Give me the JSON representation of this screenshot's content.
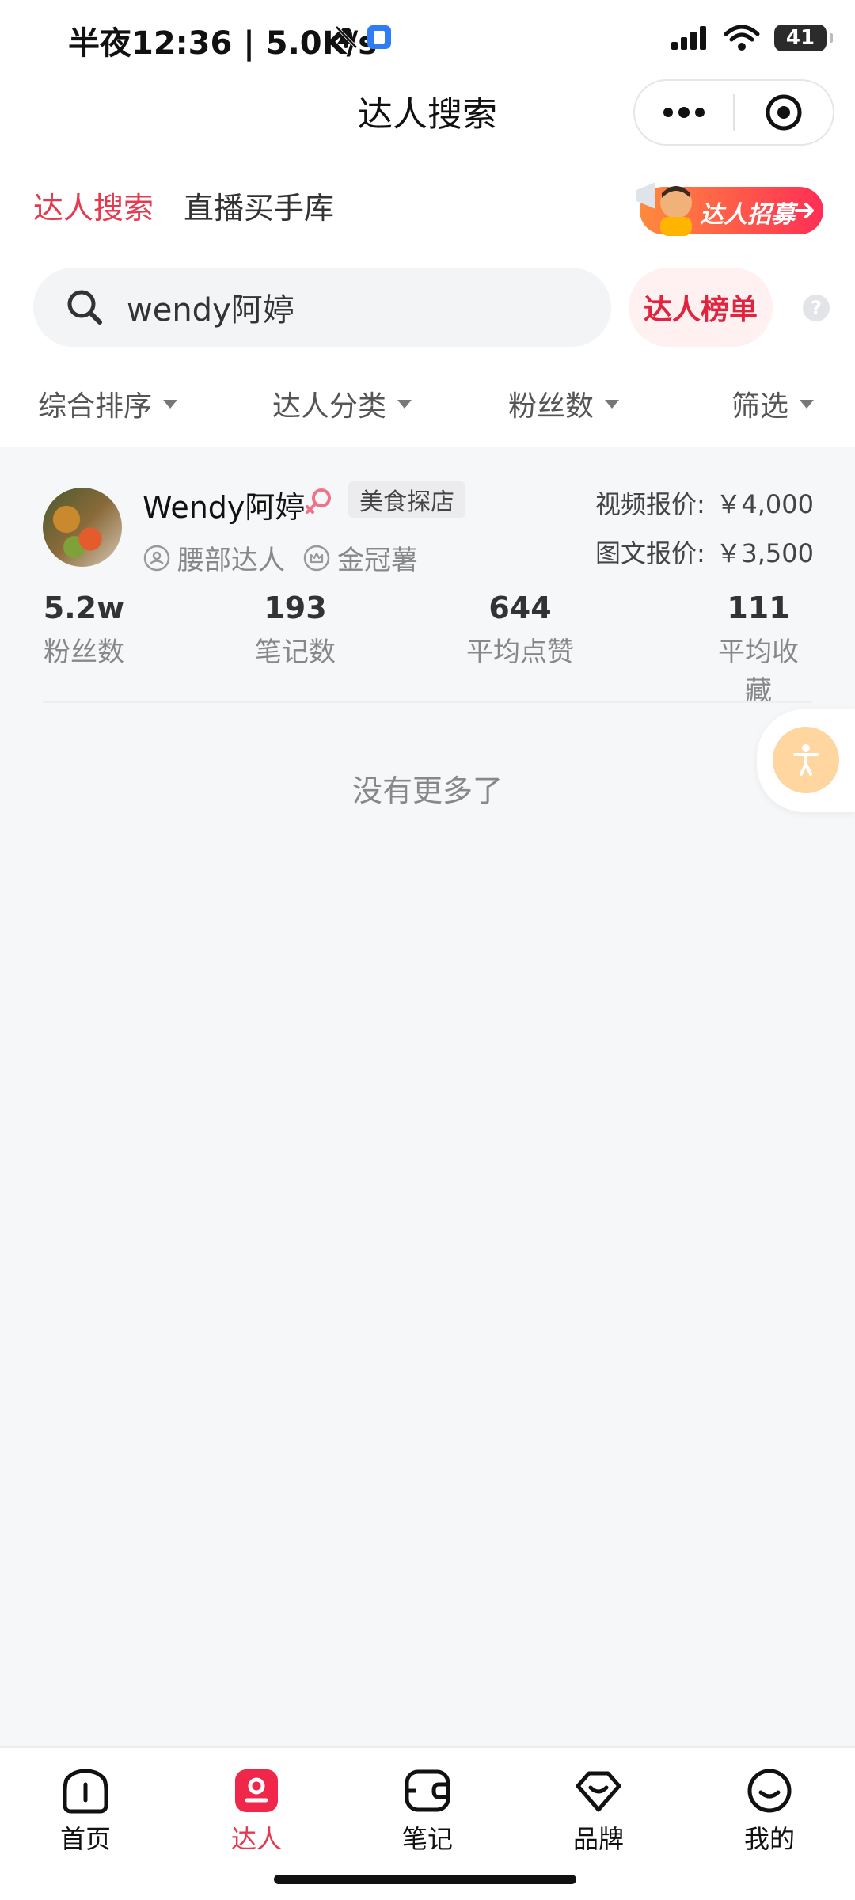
{
  "status_bar": {
    "time": "半夜12:36 | 5.0K/s",
    "battery": "41",
    "icons": [
      "bell-muted-icon",
      "app-notification-icon",
      "signal-icon",
      "wifi-icon",
      "battery-icon"
    ]
  },
  "header": {
    "title": "达人搜索",
    "icons": [
      "more-icon",
      "target-icon"
    ]
  },
  "tabs": [
    {
      "label": "达人搜索",
      "active": true
    },
    {
      "label": "直播买手库",
      "active": false
    }
  ],
  "recruit_banner": {
    "label": "达人招募",
    "icon": "megaphone-icon"
  },
  "search": {
    "value": "wendy阿婷",
    "icon": "search-icon"
  },
  "rank_button": {
    "label": "达人榜单"
  },
  "help": {
    "label": "?"
  },
  "filters": [
    {
      "label": "综合排序"
    },
    {
      "label": "达人分类"
    },
    {
      "label": "粉丝数"
    },
    {
      "label": "筛选"
    }
  ],
  "result": {
    "name": "Wendy阿婷",
    "gender_icon": "female-icon",
    "category": "美食探店",
    "levels": [
      {
        "label": "腰部达人",
        "icon": "person-circle-icon"
      },
      {
        "label": "金冠薯",
        "icon": "crown-circle-icon"
      }
    ],
    "prices": [
      {
        "label": "视频报价:",
        "value": "￥4,000"
      },
      {
        "label": "图文报价:",
        "value": "￥3,500"
      }
    ],
    "stats": [
      {
        "value": "5.2w",
        "label": "粉丝数"
      },
      {
        "value": "193",
        "label": "笔记数"
      },
      {
        "value": "644",
        "label": "平均点赞"
      },
      {
        "value": "111",
        "label": "平均收藏"
      }
    ]
  },
  "end_text": "没有更多了",
  "bottom_nav": [
    {
      "label": "首页",
      "icon": "home-icon",
      "active": false
    },
    {
      "label": "达人",
      "icon": "kol-icon",
      "active": true
    },
    {
      "label": "笔记",
      "icon": "note-icon",
      "active": false
    },
    {
      "label": "品牌",
      "icon": "brand-icon",
      "active": false
    },
    {
      "label": "我的",
      "icon": "profile-icon",
      "active": false
    }
  ],
  "colors": {
    "accent": "#e5394d",
    "rank_bg": "#fff0f2",
    "float_button": "#ffd5a0",
    "background": "#f6f7f9"
  }
}
